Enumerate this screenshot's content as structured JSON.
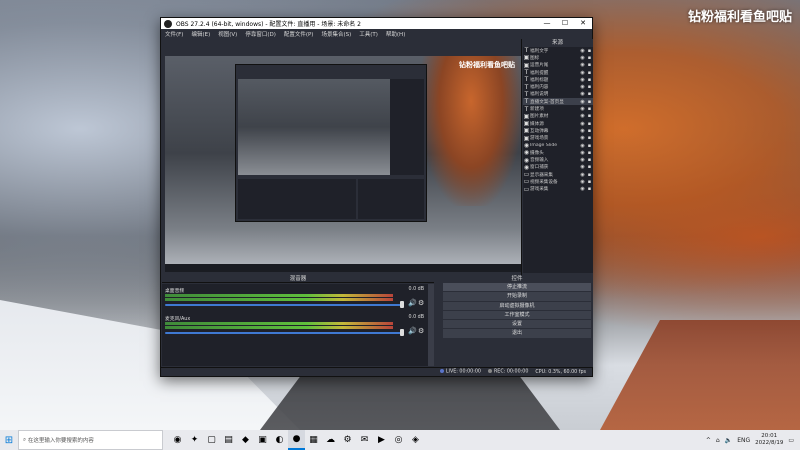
{
  "desktop": {
    "watermark": "钻粉福利看鱼吧贴"
  },
  "obs": {
    "title": "OBS 27.2.4 (64-bit, windows) - 配置文件: 直播用 - 场景: 未命名 2",
    "window_controls": {
      "minimize": "—",
      "maximize": "☐",
      "close": "✕"
    },
    "menu": [
      "文件(F)",
      "编辑(E)",
      "视图(V)",
      "停靠窗口(D)",
      "配置文件(P)",
      "场景集合(S)",
      "工具(T)",
      "帮助(H)"
    ],
    "preview": {
      "overlay_text": "钻粉福利看鱼吧贴"
    },
    "sources": {
      "title": "来源",
      "items": [
        {
          "icon": "T",
          "name": "福利文字",
          "selected": false
        },
        {
          "icon": "▣",
          "name": "图标",
          "selected": false
        },
        {
          "icon": "▣",
          "name": "运营片尾",
          "selected": false
        },
        {
          "icon": "T",
          "name": "福利提醒",
          "selected": false
        },
        {
          "icon": "T",
          "name": "福利标题",
          "selected": false
        },
        {
          "icon": "T",
          "name": "福利内容",
          "selected": false
        },
        {
          "icon": "T",
          "name": "福利说明",
          "selected": false
        },
        {
          "icon": "T",
          "name": "直播文案-首页显",
          "selected": true
        },
        {
          "icon": "T",
          "name": "新建项",
          "selected": false
        },
        {
          "icon": "▣",
          "name": "图片素材",
          "selected": false
        },
        {
          "icon": "▣",
          "name": "媒体源",
          "selected": false
        },
        {
          "icon": "▣",
          "name": "互动弹幕",
          "selected": false
        },
        {
          "icon": "▣",
          "name": "游戏场景",
          "selected": false
        },
        {
          "icon": "◉",
          "name": "Image Slide",
          "selected": false
        },
        {
          "icon": "◉",
          "name": "摄像头",
          "selected": false
        },
        {
          "icon": "◉",
          "name": "音频输入",
          "selected": false
        },
        {
          "icon": "◉",
          "name": "窗口捕获",
          "selected": false
        },
        {
          "icon": "▭",
          "name": "显示器采集",
          "selected": false
        },
        {
          "icon": "▭",
          "name": "视频采集设备",
          "selected": false
        },
        {
          "icon": "▭",
          "name": "游戏采集",
          "selected": false
        }
      ],
      "tools": [
        "+",
        "−",
        "⚙",
        "∧",
        "∨"
      ]
    },
    "mixer": {
      "title": "混音器",
      "tracks": [
        {
          "name": "桌面音频",
          "db": "0.0 dB",
          "level": 0.97
        },
        {
          "name": "麦克风/Aux",
          "db": "0.0 dB",
          "level": 0.97
        }
      ]
    },
    "controls": {
      "title": "控件",
      "buttons": [
        "停止推流",
        "开始录制",
        "启动虚拟摄像机",
        "工作室模式",
        "设置",
        "退出"
      ]
    },
    "status": {
      "live": "LIVE: 00:00:00",
      "rec": "REC: 00:00:00",
      "cpu": "CPU: 0.3%, 60.00 fps"
    }
  },
  "taskbar": {
    "search_placeholder": "在这里输入你要搜索的内容",
    "start_icon": "⊞",
    "apps": [
      "◉",
      "✦",
      "▢",
      "▤",
      "◆",
      "▣",
      "◐",
      "●",
      "▦",
      "☁",
      "⚙",
      "✉",
      "▶",
      "◎",
      "◈"
    ],
    "tray": {
      "language": "ENG",
      "time": "20:01",
      "date": "2022/8/19"
    }
  }
}
